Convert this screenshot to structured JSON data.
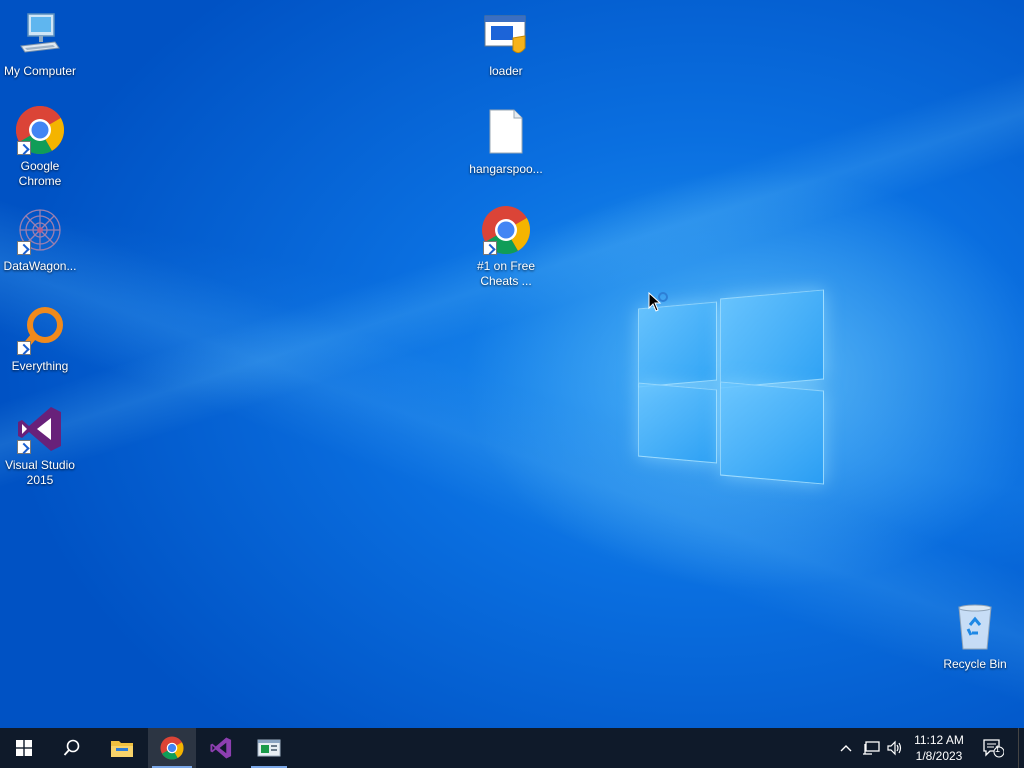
{
  "desktop": {
    "icons": [
      {
        "label": "My Computer",
        "icon": "computer-icon"
      },
      {
        "label": "Google Chrome",
        "icon": "chrome-icon"
      },
      {
        "label": "DataWagon...",
        "icon": "datawagon-icon"
      },
      {
        "label": "Everything",
        "icon": "everything-search-icon"
      },
      {
        "label": "Visual Studio 2015",
        "icon": "visual-studio-icon"
      },
      {
        "label": "loader",
        "icon": "loader-exe-icon"
      },
      {
        "label": "hangarspoo...",
        "icon": "blank-file-icon"
      },
      {
        "label": "#1 on Free Cheats ...",
        "icon": "chrome-icon"
      },
      {
        "label": "Recycle Bin",
        "icon": "recycle-bin-icon"
      }
    ]
  },
  "taskbar": {
    "start": "windows-start-icon",
    "search": "search-icon",
    "apps": [
      {
        "name": "file-explorer-icon"
      },
      {
        "name": "chrome-icon"
      },
      {
        "name": "visual-studio-icon"
      },
      {
        "name": "loader-window-icon"
      }
    ],
    "tray": {
      "chevron": "show-hidden-icons-chevron",
      "network": "network-icon",
      "volume": "volume-icon",
      "time": "11:12 AM",
      "date": "1/8/2023",
      "notification_count": "1"
    }
  },
  "colors": {
    "wallpaper": "#0a6fe0",
    "taskbar": "#0f1a2a",
    "accent": "#7aa7e8"
  }
}
